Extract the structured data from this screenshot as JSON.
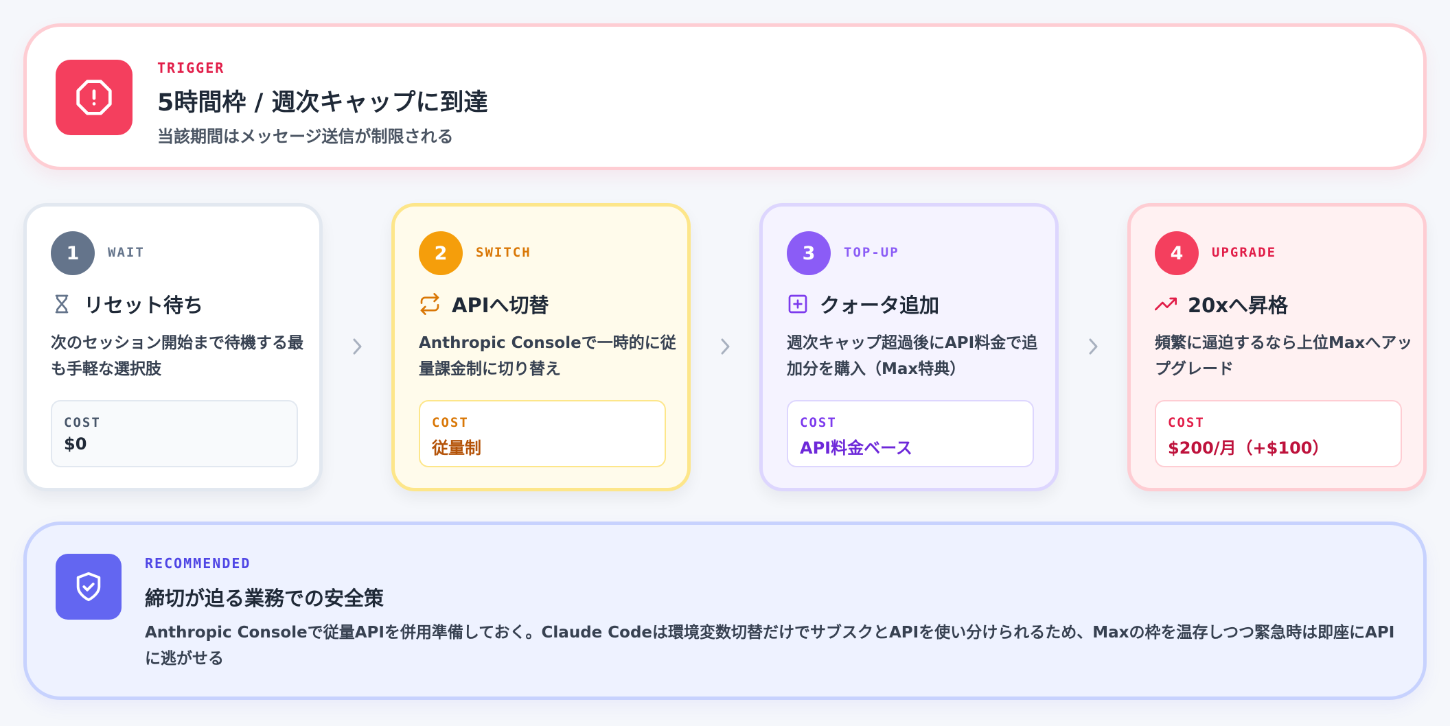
{
  "trigger": {
    "tag": "TRIGGER",
    "title": "5時間枠 / 週次キャップに到達",
    "subtitle": "当該期間はメッセージ送信が制限される",
    "icon": "alert-octagon-icon",
    "color": "#f43f5e"
  },
  "steps": [
    {
      "number": "1",
      "tag": "WAIT",
      "icon": "hourglass-icon",
      "title": "リセット待ち",
      "description": "次のセッション開始まで待機する最も手軽な選択肢",
      "cost_label": "COST",
      "cost_value": "$0",
      "color": "#64748b"
    },
    {
      "number": "2",
      "tag": "SWITCH",
      "icon": "switch-arrows-icon",
      "title": "APIへ切替",
      "description": "Anthropic Consoleで一時的に従量課金制に切り替え",
      "cost_label": "COST",
      "cost_value": "従量制",
      "color": "#f59e0b"
    },
    {
      "number": "3",
      "tag": "TOP-UP",
      "icon": "plus-square-icon",
      "title": "クォータ追加",
      "description": "週次キャップ超過後にAPI料金で追加分を購入（Max特典）",
      "cost_label": "COST",
      "cost_value": "API料金ベース",
      "color": "#8b5cf6"
    },
    {
      "number": "4",
      "tag": "UPGRADE",
      "icon": "trending-up-icon",
      "title": "20xへ昇格",
      "description": "頻繁に逼迫するなら上位Maxへアップグレード",
      "cost_label": "COST",
      "cost_value": "$200/月（+$100）",
      "color": "#f43f5e"
    }
  ],
  "recommended": {
    "tag": "RECOMMENDED",
    "title": "締切が迫る業務での安全策",
    "body": "Anthropic Consoleで従量APIを併用準備しておく。Claude Codeは環境変数切替だけでサブスクとAPIを使い分けられるため、Maxの枠を温存しつつ緊急時は即座にAPIに逃がせる",
    "icon": "shield-check-icon",
    "color": "#6366f1"
  }
}
